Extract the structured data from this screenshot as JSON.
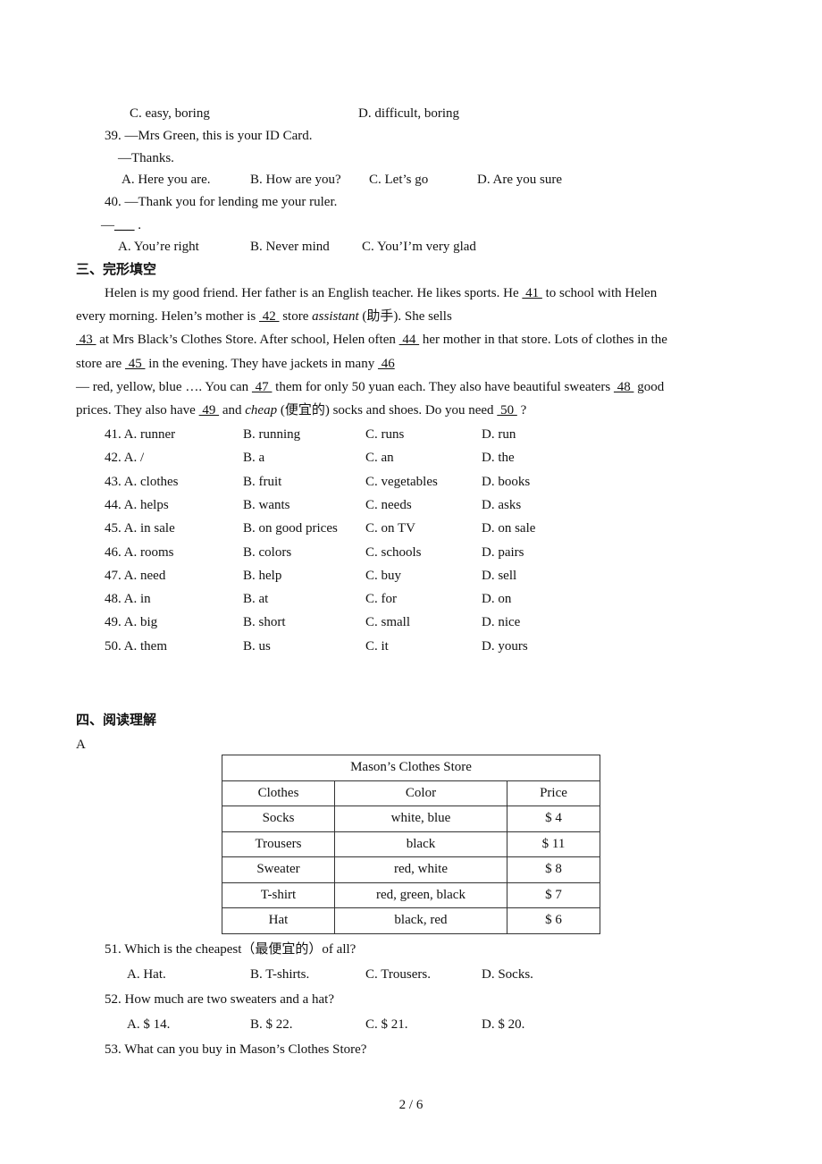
{
  "q38_tail": {
    "c": "C. easy, boring",
    "d": "D. difficult, boring"
  },
  "q39": {
    "prompt": "39. —Mrs Green, this is your ID Card.",
    "reply": "—Thanks.",
    "options": [
      "A. Here you are.",
      "B. How are you?",
      "C. Let’s go",
      "D. Are you sure"
    ]
  },
  "q40": {
    "prompt": "40. —Thank you for lending me your ruler.",
    "reply_dash": "—",
    "reply_blank": "___",
    "reply_end": " .",
    "options": [
      "A. You’re right",
      "B. Never mind",
      "C. You’I’m very glad"
    ]
  },
  "section3": {
    "heading": "三、完形填空",
    "p1a": "Helen is my good friend. Her father is an English teacher. He likes sports. He ",
    "b41": " 41 ",
    "p1b": " to school with Helen",
    "p2a": "every morning. Helen’s mother is ",
    "b42": " 42 ",
    "p2b": " store ",
    "p2it": "assistant",
    "p2c": " (助手).  She sells",
    "b43": " 43 ",
    "p3a": " at Mrs Black’s Clothes Store. After school, Helen often ",
    "b44": " 44 ",
    "p3b": " her mother in that store. Lots of clothes in the",
    "p4a": "store are ",
    "b45": " 45 ",
    "p4b": " in the evening. They have jackets in many ",
    "b46": " 46",
    "p5a": "— red, yellow, blue  …. You can ",
    "b47": " 47 ",
    "p5b": " them for only 50 yuan each. They also have beautiful sweaters ",
    "b48": " 48 ",
    "p5c": " good",
    "p6a": "prices. They also have ",
    "b49": " 49 ",
    "p6b": " and ",
    "p6it": "cheap",
    "p6c": " (便宜的) socks and shoes. Do you need  ",
    "b50": " 50 ",
    "p6d": " ?"
  },
  "cloze_options": [
    [
      "41. A. runner",
      "B. running",
      "C. runs",
      "D. run"
    ],
    [
      "42. A. /",
      "B. a",
      "C. an",
      "D. the"
    ],
    [
      "43. A. clothes",
      "B. fruit",
      "C. vegetables",
      "D. books"
    ],
    [
      "44. A. helps",
      "B. wants",
      "C. needs",
      "D. asks"
    ],
    [
      "45. A. in sale",
      "B. on good prices",
      "C. on TV",
      "D. on sale"
    ],
    [
      "46. A. rooms",
      "B. colors",
      "C. schools",
      "D. pairs"
    ],
    [
      "47. A. need",
      "B. help",
      "C. buy",
      "D. sell"
    ],
    [
      "48. A. in",
      "B. at",
      "C. for",
      "D. on"
    ],
    [
      "49. A. big",
      "B. short",
      "C. small",
      "D. nice"
    ],
    [
      "50. A. them",
      "B. us",
      "C. it",
      "D. yours"
    ]
  ],
  "section4": {
    "heading": "四、阅读理解",
    "passage_label": "A"
  },
  "store_table": {
    "title": "Mason’s Clothes Store",
    "headers": [
      "Clothes",
      "Color",
      "Price"
    ],
    "rows": [
      [
        "Socks",
        "white, blue",
        "$ 4"
      ],
      [
        "Trousers",
        "black",
        "$ 11"
      ],
      [
        "Sweater",
        "red, white",
        "$ 8"
      ],
      [
        "T-shirt",
        "red, green, black",
        "$ 7"
      ],
      [
        "Hat",
        "black, red",
        "$ 6"
      ]
    ]
  },
  "q51": {
    "prompt": "51. Which is the cheapest（最便宜的）of all?",
    "options": [
      "A. Hat.",
      "B. T-shirts.",
      "C. Trousers.",
      "D. Socks."
    ]
  },
  "q52": {
    "prompt": "52. How much are two sweaters and a hat?",
    "options": [
      "A. $ 14.",
      "B. $ 22.",
      "C. $ 21.",
      "D. $ 20."
    ]
  },
  "q53": {
    "prompt": "53. What can you buy in Mason’s Clothes Store?"
  },
  "footer": {
    "page": "2 / 6"
  }
}
